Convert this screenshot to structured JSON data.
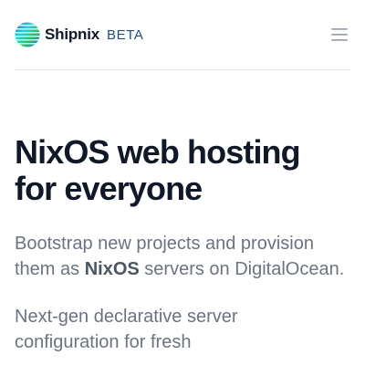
{
  "header": {
    "brand_name": "Shipnix",
    "beta_badge": "BETA",
    "menu_icon": "hamburger-menu-icon",
    "logo_icon": "striped-globe-logo-icon",
    "logo_colors": [
      "#0f5d8f",
      "#22c55e",
      "#22d3ee",
      "#3b82f6"
    ]
  },
  "hero": {
    "title_line_1": "NixOS web hosting",
    "title_line_2": "for everyone",
    "intro_before": "Bootstrap new projects and provision them as ",
    "intro_bold": "NixOS",
    "intro_after": " servers on DigitalOcean.",
    "secondary_visible": "Next-gen declarative server configuration for fresh"
  },
  "colors": {
    "text_dark": "#111827",
    "text_muted": "#6b7280",
    "beta_blue": "#1f4e79",
    "divider": "#e5e7eb"
  }
}
